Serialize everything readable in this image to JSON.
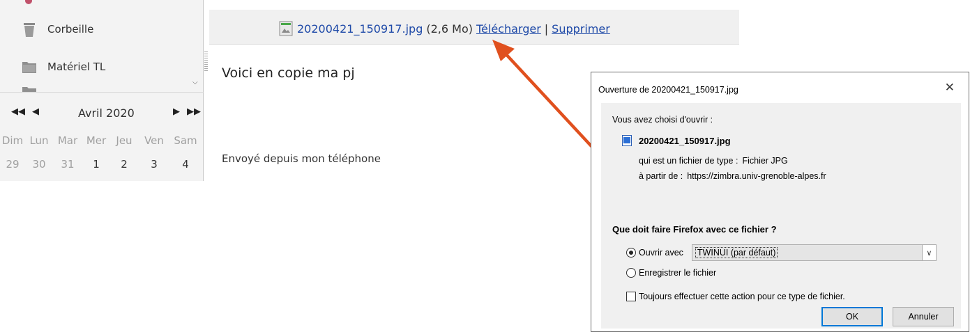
{
  "sidebar": {
    "folders": [
      {
        "label": "Corbeille",
        "icon": "trash-icon"
      },
      {
        "label": "Matériel TL",
        "icon": "folder-icon"
      }
    ]
  },
  "calendar": {
    "month": "Avril 2020",
    "weekdays": [
      "Dim",
      "Lun",
      "Mar",
      "Mer",
      "Jeu",
      "Ven",
      "Sam"
    ],
    "dates": [
      "29",
      "30",
      "31",
      "1",
      "2",
      "3",
      "4"
    ]
  },
  "message": {
    "attachment": {
      "filename": "20200421_150917.jpg",
      "size": "(2,6 Mo)",
      "download_label": "Télécharger",
      "separator": "|",
      "delete_label": "Supprimer"
    },
    "body": "Voici en copie ma pj",
    "signature": "Envoyé depuis  mon téléphone"
  },
  "dialog": {
    "title": "Ouverture de 20200421_150917.jpg",
    "close": "✕",
    "intro": "Vous avez choisi d'ouvrir :",
    "filename": "20200421_150917.jpg",
    "type_label": "qui est un fichier de type :",
    "type_value": "Fichier JPG",
    "from_label": "à partir de :",
    "from_value": "https://zimbra.univ-grenoble-alpes.fr",
    "question": "Que doit faire Firefox avec ce fichier ?",
    "open_with_label": "Ouvrir avec",
    "open_with_value": "TWINUI (par défaut)",
    "save_label": "Enregistrer le fichier",
    "always_label": "Toujours effectuer cette action pour ce type de fichier.",
    "ok_label": "OK",
    "cancel_label": "Annuler"
  },
  "colors": {
    "link": "#1f4aa8",
    "arrow": "#e0501e",
    "focus": "#0078d7"
  }
}
